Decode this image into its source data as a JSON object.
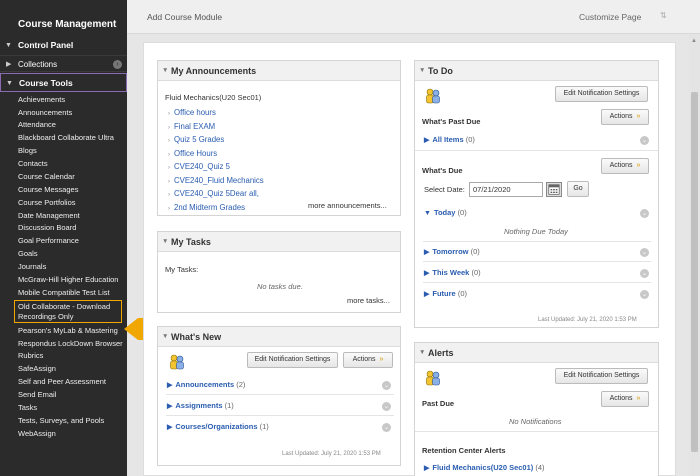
{
  "sidebar": {
    "title": "Course Management",
    "control_panel": "Control Panel",
    "collections": "Collections",
    "course_tools": "Course Tools",
    "items": [
      "Achievements",
      "Announcements",
      "Attendance",
      "Blackboard Collaborate Ultra",
      "Blogs",
      "Contacts",
      "Course Calendar",
      "Course Messages",
      "Course Portfolios",
      "Date Management",
      "Discussion Board",
      "Goal Performance",
      "Goals",
      "Journals",
      "McGraw-Hill Higher Education",
      "Mobile Compatible Test List",
      "Old Collaborate - Download Recordings Only",
      "Pearson's MyLab & Mastering",
      "Respondus LockDown Browser",
      "Rubrics",
      "SafeAssign",
      "Self and Peer Assessment",
      "Send Email",
      "Tasks",
      "Tests, Surveys, and Pools",
      "WebAssign"
    ],
    "highlight_color": "#f0a800"
  },
  "topbar": {
    "add_module": "Add Course Module",
    "customize": "Customize Page"
  },
  "announcements": {
    "title": "My Announcements",
    "course": "Fluid Mechanics(U20 Sec01)",
    "items": [
      "Office hours",
      "Final EXAM",
      "Quiz 5 Grades",
      "Office Hours",
      "CVE240_Quiz 5",
      "CVE240_Fluid Mechanics",
      "CVE240_Quiz 5Dear all,",
      "2nd Midterm Grades"
    ],
    "more": "more announcements..."
  },
  "tasks": {
    "title": "My Tasks",
    "label": "My Tasks:",
    "empty": "No tasks due.",
    "more": "more tasks..."
  },
  "whatsnew": {
    "title": "What's New",
    "notif_btn": "Edit Notification Settings",
    "actions_btn": "Actions",
    "rows": [
      {
        "label": "Announcements",
        "count": "(2)"
      },
      {
        "label": "Assignments",
        "count": "(1)"
      },
      {
        "label": "Courses/Organizations",
        "count": "(1)"
      }
    ],
    "updated": "Last Updated: July 21, 2020 1:53 PM"
  },
  "todo": {
    "title": "To Do",
    "notif_btn": "Edit Notification Settings",
    "actions_btn": "Actions",
    "past_due": "What's Past Due",
    "all_items": "All Items",
    "all_items_count": "(0)",
    "whats_due": "What's Due",
    "select_date_label": "Select Date:",
    "date_value": "07/21/2020",
    "go_btn": "Go",
    "today": "Today",
    "today_count": "(0)",
    "nothing_due": "Nothing Due Today",
    "tomorrow": "Tomorrow",
    "tomorrow_count": "(0)",
    "this_week": "This Week",
    "this_week_count": "(0)",
    "future": "Future",
    "future_count": "(0)",
    "updated": "Last Updated: July 21, 2020 1:53 PM"
  },
  "alerts": {
    "title": "Alerts",
    "notif_btn": "Edit Notification Settings",
    "actions_btn": "Actions",
    "past_due": "Past Due",
    "no_notif": "No Notifications",
    "retention": "Retention Center Alerts",
    "course": "Fluid Mechanics(U20 Sec01)",
    "course_count": "(4)"
  }
}
